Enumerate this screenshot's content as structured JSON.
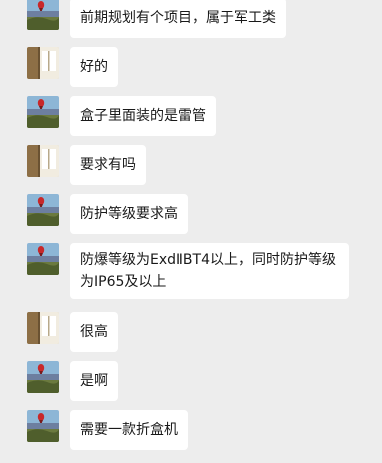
{
  "app": "chat",
  "palette": {
    "background": "#ededed",
    "bubble": "#ffffff",
    "text": "#191919"
  },
  "messages": [
    {
      "sender": "contact-a",
      "text": "前期规划有个项目，属于军工类"
    },
    {
      "sender": "contact-b",
      "text": "好的"
    },
    {
      "sender": "contact-a",
      "text": "盒子里面装的是雷管"
    },
    {
      "sender": "contact-b",
      "text": "要求有吗"
    },
    {
      "sender": "contact-a",
      "text": "防护等级要求高"
    },
    {
      "sender": "contact-a",
      "text": "防爆等级为ExdⅡBT4以上，同时防护等级为IP65及以上"
    },
    {
      "sender": "contact-b",
      "text": "很高"
    },
    {
      "sender": "contact-a",
      "text": "是啊"
    },
    {
      "sender": "contact-a",
      "text": "需要一款折盒机"
    }
  ]
}
